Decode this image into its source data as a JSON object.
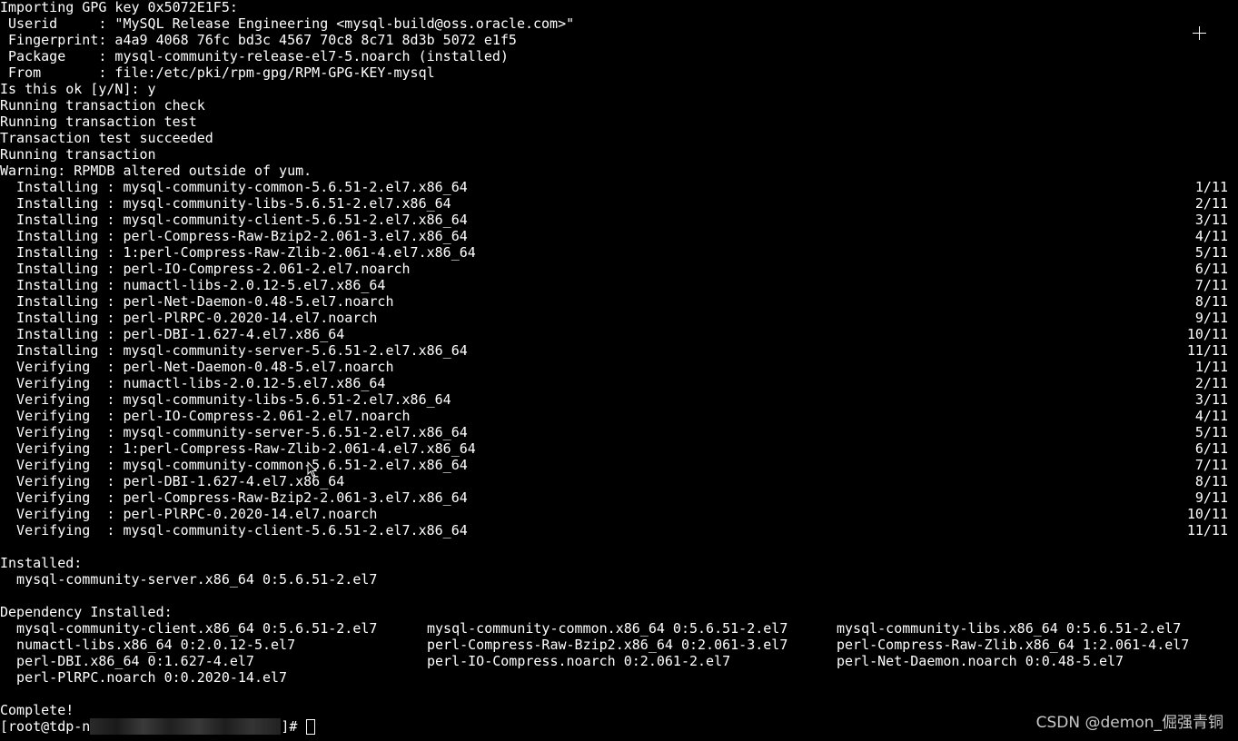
{
  "gpg": [
    "Importing GPG key 0x5072E1F5:",
    " Userid     : \"MySQL Release Engineering <mysql-build@oss.oracle.com>\"",
    " Fingerprint: a4a9 4068 76fc bd3c 4567 70c8 8c71 8d3b 5072 e1f5",
    " Package    : mysql-community-release-el7-5.noarch (installed)",
    " From       : file:/etc/pki/rpm-gpg/RPM-GPG-KEY-mysql"
  ],
  "prompt_line": "Is this ok [y/N]: y",
  "transaction": [
    "Running transaction check",
    "Running transaction test",
    "Transaction test succeeded",
    "Running transaction",
    "Warning: RPMDB altered outside of yum."
  ],
  "steps": [
    {
      "text": "  Installing : mysql-community-common-5.6.51-2.el7.x86_64",
      "count": "1/11"
    },
    {
      "text": "  Installing : mysql-community-libs-5.6.51-2.el7.x86_64",
      "count": "2/11"
    },
    {
      "text": "  Installing : mysql-community-client-5.6.51-2.el7.x86_64",
      "count": "3/11"
    },
    {
      "text": "  Installing : perl-Compress-Raw-Bzip2-2.061-3.el7.x86_64",
      "count": "4/11"
    },
    {
      "text": "  Installing : 1:perl-Compress-Raw-Zlib-2.061-4.el7.x86_64",
      "count": "5/11"
    },
    {
      "text": "  Installing : perl-IO-Compress-2.061-2.el7.noarch",
      "count": "6/11"
    },
    {
      "text": "  Installing : numactl-libs-2.0.12-5.el7.x86_64",
      "count": "7/11"
    },
    {
      "text": "  Installing : perl-Net-Daemon-0.48-5.el7.noarch",
      "count": "8/11"
    },
    {
      "text": "  Installing : perl-PlRPC-0.2020-14.el7.noarch",
      "count": "9/11"
    },
    {
      "text": "  Installing : perl-DBI-1.627-4.el7.x86_64",
      "count": "10/11"
    },
    {
      "text": "  Installing : mysql-community-server-5.6.51-2.el7.x86_64",
      "count": "11/11"
    },
    {
      "text": "  Verifying  : perl-Net-Daemon-0.48-5.el7.noarch",
      "count": "1/11"
    },
    {
      "text": "  Verifying  : numactl-libs-2.0.12-5.el7.x86_64",
      "count": "2/11"
    },
    {
      "text": "  Verifying  : mysql-community-libs-5.6.51-2.el7.x86_64",
      "count": "3/11"
    },
    {
      "text": "  Verifying  : perl-IO-Compress-2.061-2.el7.noarch",
      "count": "4/11"
    },
    {
      "text": "  Verifying  : mysql-community-server-5.6.51-2.el7.x86_64",
      "count": "5/11"
    },
    {
      "text": "  Verifying  : 1:perl-Compress-Raw-Zlib-2.061-4.el7.x86_64",
      "count": "6/11"
    },
    {
      "text": "  Verifying  : mysql-community-common-5.6.51-2.el7.x86_64",
      "count": "7/11"
    },
    {
      "text": "  Verifying  : perl-DBI-1.627-4.el7.x86_64",
      "count": "8/11"
    },
    {
      "text": "  Verifying  : perl-Compress-Raw-Bzip2-2.061-3.el7.x86_64",
      "count": "9/11"
    },
    {
      "text": "  Verifying  : perl-PlRPC-0.2020-14.el7.noarch",
      "count": "10/11"
    },
    {
      "text": "  Verifying  : mysql-community-client-5.6.51-2.el7.x86_64",
      "count": "11/11"
    }
  ],
  "installed": {
    "heading": "Installed:",
    "item": "  mysql-community-server.x86_64 0:5.6.51-2.el7"
  },
  "dependency": {
    "heading": "Dependency Installed:",
    "rows": [
      [
        "  mysql-community-client.x86_64 0:5.6.51-2.el7",
        "mysql-community-common.x86_64 0:5.6.51-2.el7",
        "mysql-community-libs.x86_64 0:5.6.51-2.el7"
      ],
      [
        "  numactl-libs.x86_64 0:2.0.12-5.el7",
        "perl-Compress-Raw-Bzip2.x86_64 0:2.061-3.el7",
        "perl-Compress-Raw-Zlib.x86_64 1:2.061-4.el7"
      ],
      [
        "  perl-DBI.x86_64 0:1.627-4.el7",
        "perl-IO-Compress.noarch 0:2.061-2.el7",
        "perl-Net-Daemon.noarch 0:0.48-5.el7"
      ],
      [
        "  perl-PlRPC.noarch 0:0.2020-14.el7",
        "",
        ""
      ]
    ]
  },
  "complete": "Complete!",
  "shell_prompt": {
    "prefix": "[root@tdp-n",
    "suffix": "]# "
  },
  "watermark": "CSDN @demon_倔强青铜",
  "colors": {
    "background": "#000000",
    "text": "#ffffff"
  }
}
